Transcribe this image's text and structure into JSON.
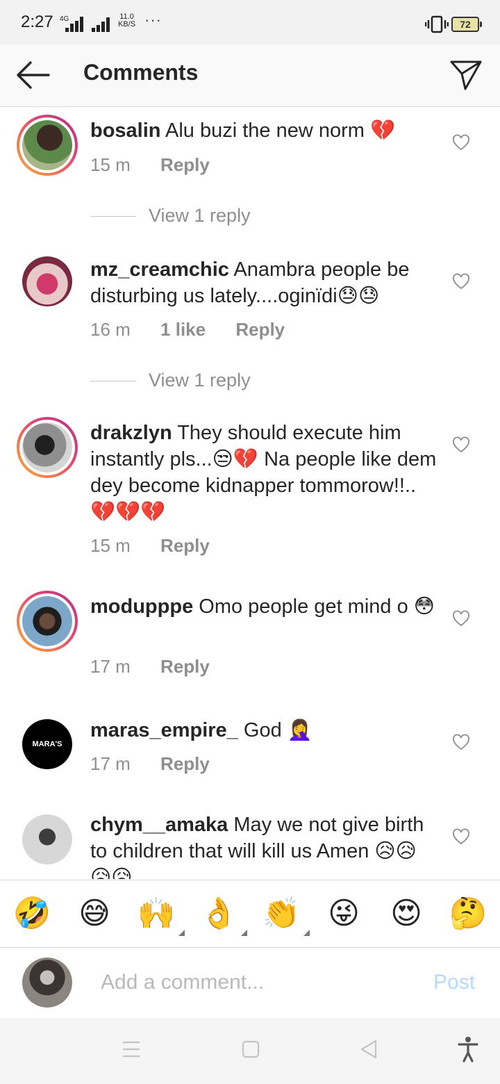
{
  "status_bar": {
    "time": "2:27",
    "network": "4G",
    "speed_value": "11.0",
    "speed_unit": "KB/S",
    "more": "···",
    "battery": "72"
  },
  "header": {
    "title": "Comments"
  },
  "comments": [
    {
      "username": "bosalin",
      "text": "Alu buzi the new norm 💔",
      "time": "15 m",
      "likes": "",
      "reply": "Reply",
      "view_replies": "View 1 reply"
    },
    {
      "username": "mz_creamchic",
      "text": "Anambra people be disturbing us lately....oginïdi😓😓",
      "time": "16 m",
      "likes": "1 like",
      "reply": "Reply",
      "view_replies": "View 1 reply"
    },
    {
      "username": "drakzlyn",
      "text": "They should execute him instantly pls...😒💔 Na people like dem dey become kidnapper tommorow!!..💔💔💔",
      "time": "15 m",
      "likes": "",
      "reply": "Reply"
    },
    {
      "username": "modupppe",
      "text": "Omo people get mind o 😳",
      "time": "17 m",
      "likes": "",
      "reply": "Reply"
    },
    {
      "username": "maras_empire_",
      "text": "God 🤦‍♀️",
      "time": "17 m",
      "likes": "",
      "reply": "Reply",
      "avatar_text": "MARA'S"
    },
    {
      "username": "chym__amaka",
      "text": "May we not give birth to children that will kill us Amen 😥😥😥😥",
      "time": "",
      "likes": "",
      "reply": ""
    }
  ],
  "emoji_bar": [
    "🤣",
    "😅",
    "🙌",
    "👌",
    "👏",
    "😜",
    "😍",
    "🤔"
  ],
  "add_comment": {
    "placeholder": "Add a comment...",
    "post_label": "Post"
  },
  "colors": {
    "link_blue_disabled": "#b3dbff",
    "meta_gray": "#8e8e8e",
    "story_ring_start": "#f9b036",
    "story_ring_end": "#b42d8f"
  }
}
